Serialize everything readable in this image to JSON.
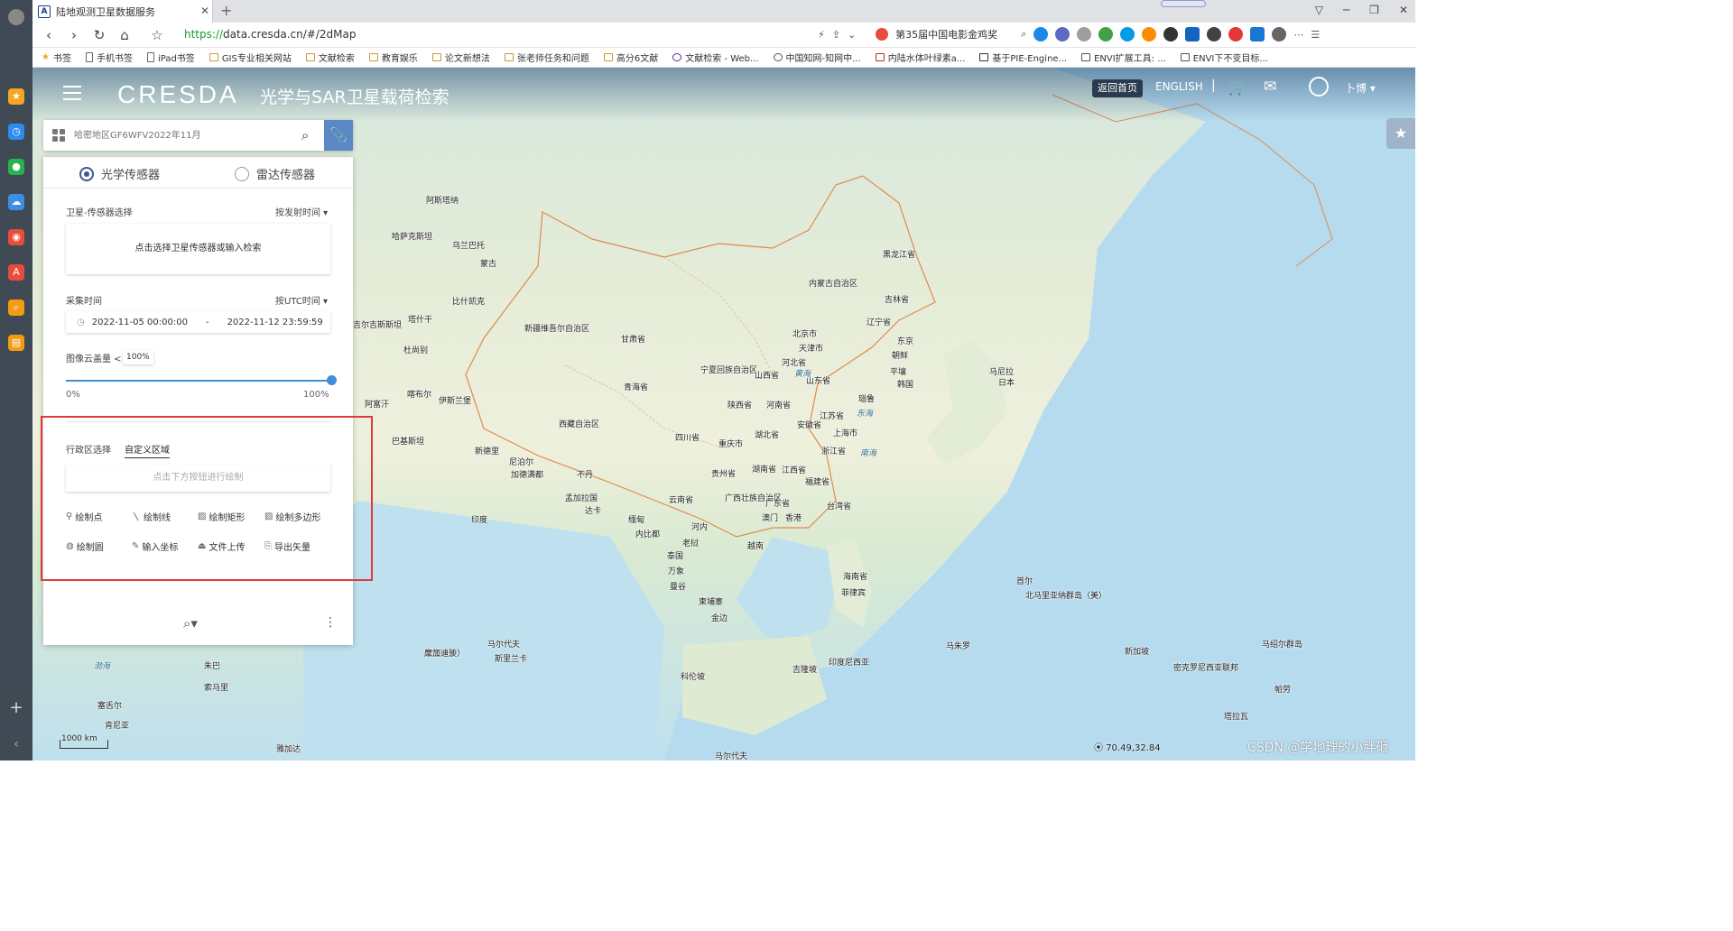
{
  "browser": {
    "tab_title": "陆地观测卫星数据服务",
    "url_scheme": "https://",
    "url_rest": "data.cresda.cn/#/2dMap",
    "hot_search": "第35届中国电影金鸡奖"
  },
  "bookmarks": [
    "书签",
    "手机书签",
    "iPad书签",
    "GIS专业相关网站",
    "文献检索",
    "教育娱乐",
    "论文新想法",
    "张老师任务和问题",
    "高分6文献",
    "文献检索 - Web...",
    "中国知网-知网中...",
    "内陆水体叶绿素a...",
    "基于PIE-Engine...",
    "ENVI扩展工具: ...",
    "ENVI下不变目标..."
  ],
  "header": {
    "logo": "CRESDA",
    "title": "光学与SAR卫星载荷检索",
    "back_home": "返回首页",
    "english": "ENGLISH",
    "separator": "|",
    "user": "卜博"
  },
  "search": {
    "placeholder": "哈密地区GF6WFV2022年11月"
  },
  "panel": {
    "optical": "光学传感器",
    "radar": "雷达传感器",
    "sensor_label": "卫星-传感器选择",
    "sensor_sort": "按发射时间 ▾",
    "sensor_hint": "点击选择卫星传感器或输入检索",
    "time_label": "采集时间",
    "time_sort": "按UTC时间 ▾",
    "time_start": "2022-11-05 00:00:00",
    "time_dash": "-",
    "time_end": "2022-11-12 23:59:59",
    "cloud_label": "图像云盖量 <",
    "cloud_value": "100%",
    "cloud_min": "0%",
    "cloud_max": "100%",
    "region_tab_admin": "行政区选择",
    "region_tab_custom": "自定义区域",
    "draw_hint": "点击下方按钮进行绘制",
    "tools": [
      "绘制点",
      "绘制线",
      "绘制矩形",
      "绘制多边形",
      "绘制圆",
      "输入坐标",
      "文件上传",
      "导出矢量"
    ]
  },
  "map": {
    "scale": "1000 km",
    "coords": "70.49,32.84",
    "watermark": "CSDN @学地理的小胖砸",
    "labels": [
      "阿斯塔纳",
      "哈萨克斯坦",
      "乌兰巴托",
      "蒙古",
      "黑龙江省",
      "吉林省",
      "内蒙古自治区",
      "辽宁省",
      "比什凯克",
      "塔什干",
      "吉尔吉斯斯坦",
      "杜尚别",
      "新疆维吾尔自治区",
      "甘肃省",
      "北京市",
      "天津市",
      "河北省",
      "宁夏回族自治区",
      "山西省",
      "山东省",
      "青海省",
      "陕西省",
      "河南省",
      "江苏省",
      "安徽省",
      "上海市",
      "西藏自治区",
      "四川省",
      "湖北省",
      "浙江省",
      "重庆市",
      "阿富汗",
      "伊斯兰堡",
      "巴基斯坦",
      "喀布尔",
      "新德里",
      "尼泊尔",
      "加德满都",
      "不丹",
      "湖南省",
      "江西省",
      "福建省",
      "贵州省",
      "云南省",
      "广西壮族自治区",
      "广东省",
      "台湾省",
      "澳门",
      "香港",
      "孟加拉国",
      "达卡",
      "印度",
      "缅甸",
      "内比都",
      "河内",
      "老挝",
      "泰国",
      "万象",
      "曼谷",
      "柬埔寨",
      "金边",
      "越南",
      "海南省",
      "菲律宾",
      "马尼拉",
      "日本",
      "东京",
      "朝鲜",
      "平壤",
      "韩国",
      "首尔",
      "北马里亚纳群岛（美）",
      "关岛（美）",
      "马尔代夫",
      "斯里兰卡",
      "科伦坡",
      "吉隆坡",
      "印度尼西亚",
      "新加坡",
      "密克罗尼西亚联邦",
      "马绍尔群岛",
      "马朱罗",
      "帕劳",
      "塔拉瓦",
      "瑙鲁",
      "南海",
      "东海",
      "黄海",
      "渤海",
      "朱巴",
      "索马里",
      "摩加迪沙",
      "马尔代夫",
      "雅加达",
      "塞舌尔",
      "肯尼亚",
      "内罗毕"
    ]
  }
}
